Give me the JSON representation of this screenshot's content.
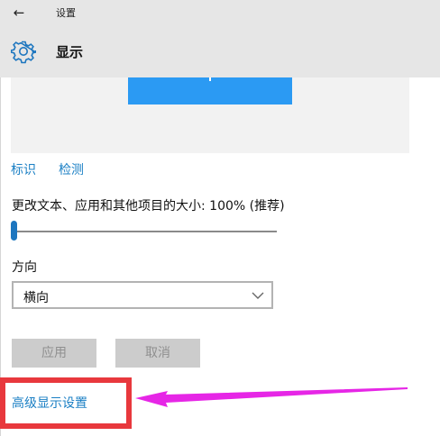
{
  "titlebar": {
    "back_icon": "back-arrow-icon",
    "app_name": "设置"
  },
  "header": {
    "icon": "gear-icon",
    "title": "显示"
  },
  "display_preview": {
    "monitor_color": "#2b9af3"
  },
  "links": {
    "identify": "标识",
    "detect": "检测"
  },
  "scale": {
    "label": "更改文本、应用和其他项目的大小: 100% (推荐)",
    "level_fraction": 0.0
  },
  "orientation": {
    "label": "方向",
    "value": "横向"
  },
  "buttons": {
    "apply": "应用",
    "cancel": "取消"
  },
  "advanced": {
    "link": "高级显示设置"
  },
  "annotations": {
    "highlight_color": "#e8383d",
    "arrow_color": "#e626e6"
  }
}
